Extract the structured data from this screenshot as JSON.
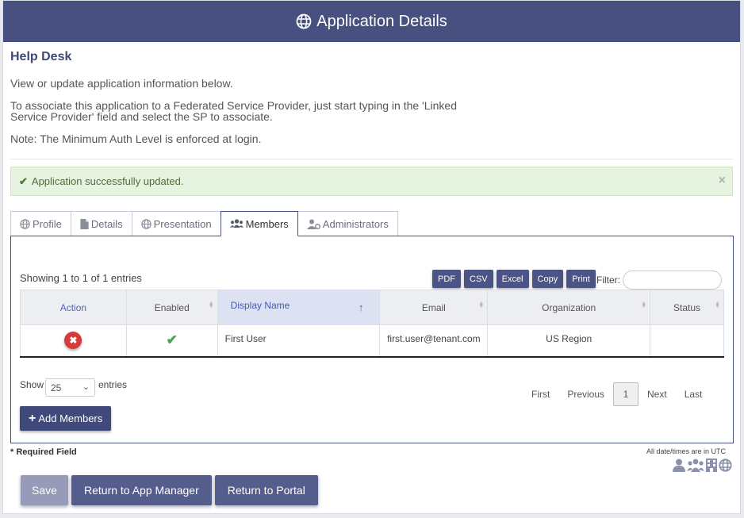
{
  "header": {
    "title": "Application Details",
    "icon": "globe-icon"
  },
  "app_name": "Help Desk",
  "intro": {
    "line1": "View or update application information below.",
    "line2": "To associate this application to a Federated Service Provider, just start typing in the 'Linked Service Provider' field and select the SP to associate.",
    "line3": "Note: The Minimum Auth Level is enforced at login."
  },
  "alert": {
    "message": "Application successfully updated.",
    "close": "×"
  },
  "tabs": [
    {
      "label": "Profile",
      "icon": "globe-icon"
    },
    {
      "label": "Details",
      "icon": "document-icon"
    },
    {
      "label": "Presentation",
      "icon": "globe-icon"
    },
    {
      "label": "Members",
      "icon": "users-icon",
      "active": true
    },
    {
      "label": "Administrators",
      "icon": "admin-icon"
    }
  ],
  "members": {
    "info": "Showing 1 to 1 of 1 entries",
    "export_buttons": [
      "PDF",
      "CSV",
      "Excel",
      "Copy",
      "Print"
    ],
    "filter_label": "Filter:",
    "filter_value": "",
    "columns": [
      "Action",
      "Enabled",
      "Display Name",
      "Email",
      "Organization",
      "Status"
    ],
    "sort_indicator": "↑",
    "rows": [
      {
        "enabled": "✔",
        "display_name": "First User",
        "email": "first.user@tenant.com",
        "organization": "US Region",
        "status": ""
      }
    ],
    "show_label": "Show",
    "page_length": "25",
    "entries_label": "entries",
    "pager": {
      "first": "First",
      "previous": "Previous",
      "current": "1",
      "next": "Next",
      "last": "Last"
    },
    "add_button": "Add Members"
  },
  "footer": {
    "required": "* Required Field",
    "utc_note": "All date/times are in UTC",
    "buttons": {
      "save": "Save",
      "return_app_manager": "Return to App Manager",
      "return_portal": "Return to Portal"
    }
  },
  "colors": {
    "header": "#47507f",
    "button": "#545d8c",
    "alert_bg": "#e7f3e1",
    "danger": "#d9393a",
    "success": "#4aa64a"
  }
}
